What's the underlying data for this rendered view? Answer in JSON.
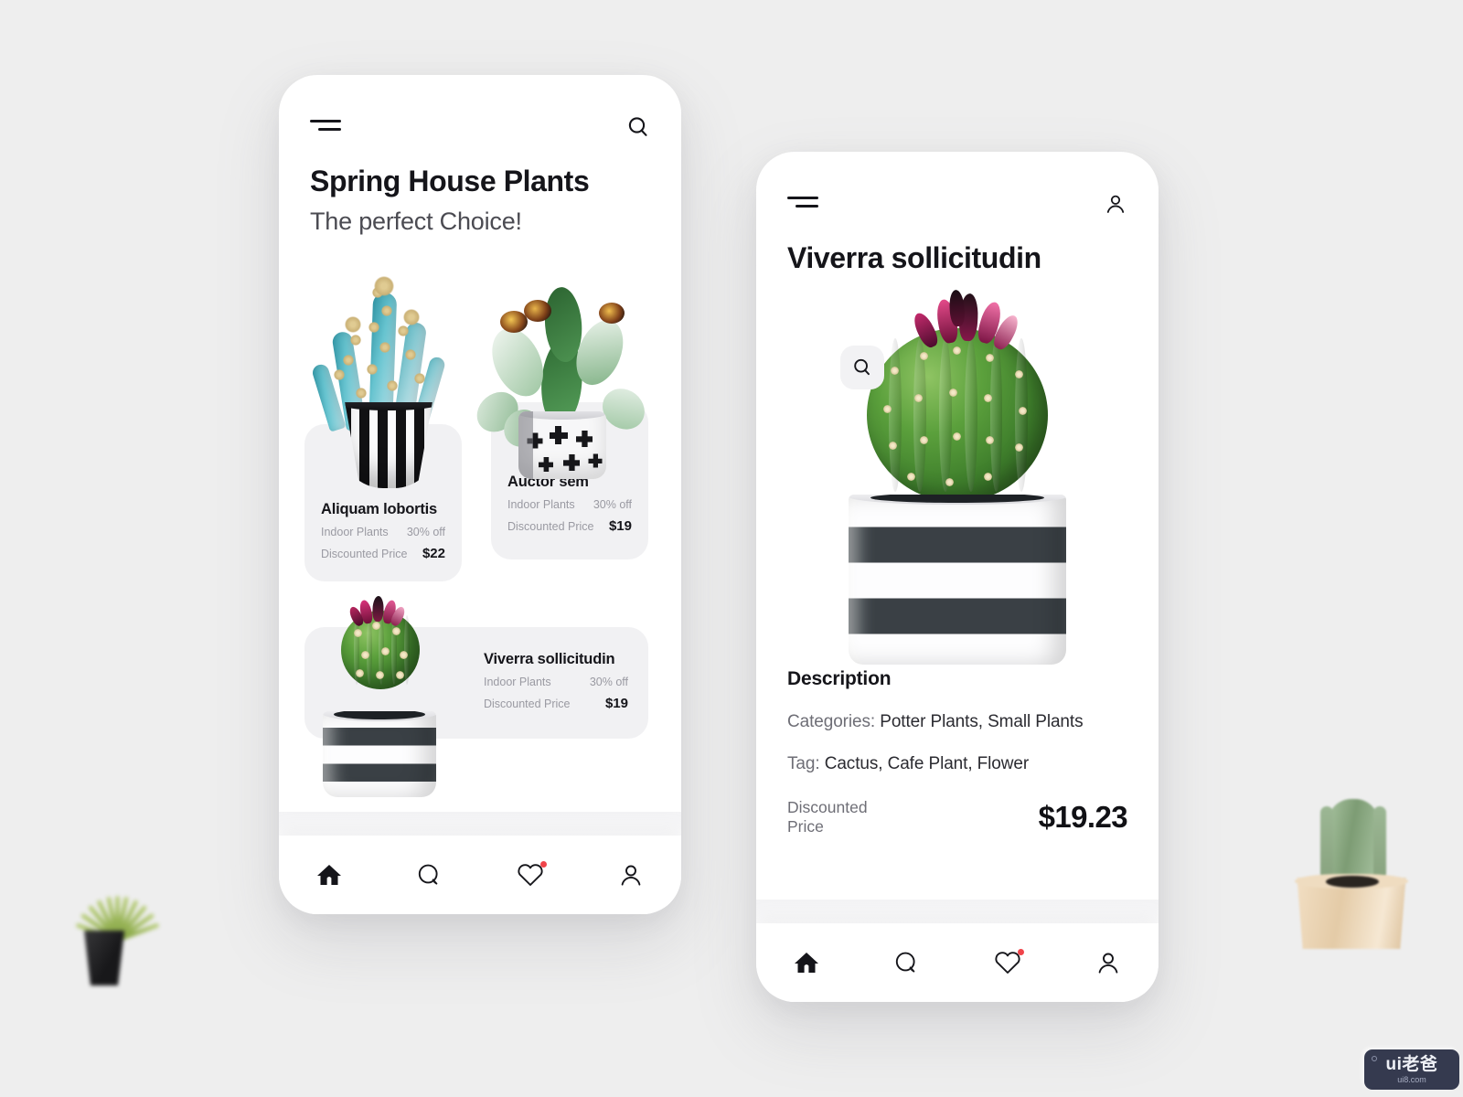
{
  "background": {
    "color": "#eeeeee",
    "decor_left": {
      "name": "grass-plant-in-dark-pot"
    },
    "decor_right": {
      "name": "cactus-in-wooden-pot"
    }
  },
  "watermark": {
    "main": "ui老爸",
    "sub": "ui8.com"
  },
  "home_screen": {
    "menu_icon": "hamburger-icon",
    "search_icon": "search-icon",
    "title": "Spring House Plants",
    "subtitle": "The perfect Choice!",
    "products": [
      {
        "name": "Aliquam lobortis",
        "category_label": "Indoor Plants",
        "discount": "30% off",
        "price_label": "Discounted Price",
        "price": "$22",
        "image": "teal-cactus-in-vertical-striped-pot"
      },
      {
        "name": "Auctor sem",
        "category_label": "Indoor Plants",
        "discount": "30% off",
        "price_label": "Discounted Price",
        "price": "$19",
        "image": "prickly-pear-cactus-in-cross-pattern-pot"
      },
      {
        "name": "Viverra sollicitudin",
        "category_label": "Indoor Plants",
        "discount": "30% off",
        "price_label": "Discounted Price",
        "price": "$19",
        "image": "round-cactus-in-striped-pot"
      }
    ],
    "nav": [
      {
        "icon": "home-icon",
        "active": true
      },
      {
        "icon": "chat-icon",
        "active": false
      },
      {
        "icon": "heart-icon",
        "active": false,
        "badge": true
      },
      {
        "icon": "person-icon",
        "active": false
      }
    ]
  },
  "detail_screen": {
    "menu_icon": "hamburger-icon",
    "account_icon": "person-icon",
    "title": "Viverra sollicitudin",
    "search_icon": "search-icon",
    "hero_image": "round-green-cactus-with-pink-flower-in-striped-pot",
    "description_heading": "Description",
    "categories_label": "Categories:",
    "categories_value": "Potter Plants, Small Plants",
    "tag_label": "Tag:",
    "tag_value": "Cactus, Cafe Plant, Flower",
    "price_label": "Discounted\nPrice",
    "price_label_line1": "Discounted",
    "price_label_line2": "Price",
    "price": "$19.23",
    "nav": [
      {
        "icon": "home-icon",
        "active": true
      },
      {
        "icon": "chat-icon",
        "active": false
      },
      {
        "icon": "heart-icon",
        "active": false,
        "badge": true
      },
      {
        "icon": "person-icon",
        "active": false
      }
    ]
  },
  "colors": {
    "page_bg": "#eeeeee",
    "card_bg": "#f1f1f3",
    "text_primary": "#15151a",
    "text_secondary": "#6e6e76",
    "text_muted": "#9a9aa2",
    "badge_red": "#f0444a",
    "watermark_bg": "#353a4f"
  }
}
